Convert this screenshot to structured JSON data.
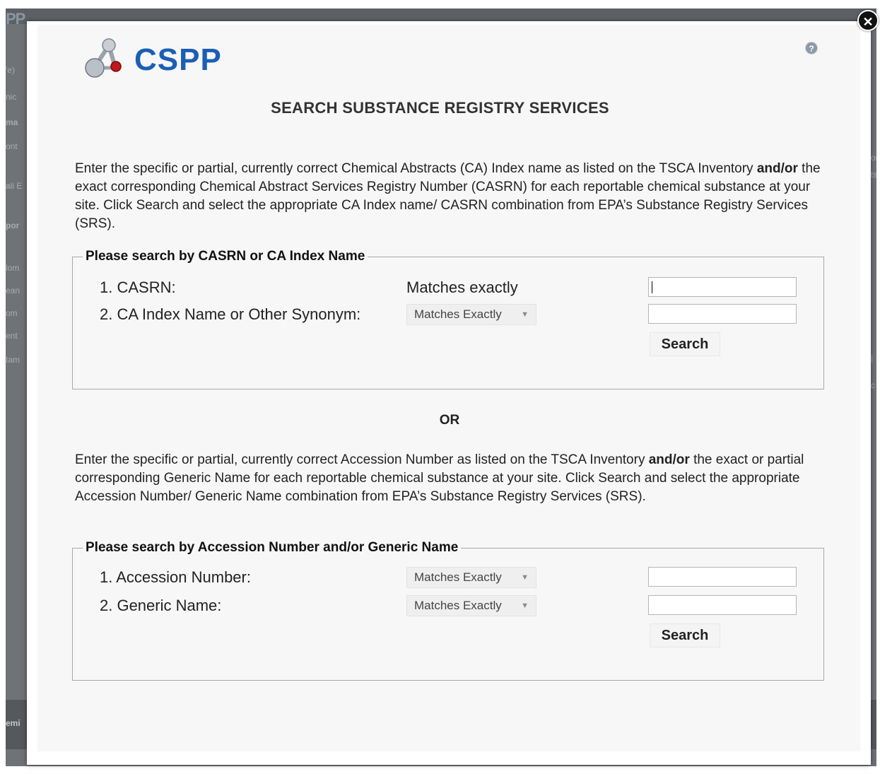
{
  "app": {
    "logo_text": "CSPP"
  },
  "background": {
    "ghost_logo": "PP",
    "side_snippets": [
      "'e)",
      "nic",
      "ma",
      "ont",
      "ali E",
      "por",
      "lom",
      "ean",
      "om",
      "ent",
      "Iam"
    ],
    "right_snippets": [
      "or",
      "ts",
      "|",
      "c"
    ],
    "bottom_text": "emi"
  },
  "dialog": {
    "title": "SEARCH SUBSTANCE REGISTRY SERVICES",
    "help_icon": "help-icon",
    "close_icon": "close-icon",
    "or_label": "OR",
    "intro1": {
      "part1": "Enter the specific or partial, currently correct Chemical Abstracts (CA) Index name as listed on the TSCA Inventory ",
      "bold1": "and/or",
      "part2": " the exact corresponding Chemical Abstract Services Registry Number (CASRN) for each reportable chemical substance at your site. Click Search and select the appropriate CA Index name/ CASRN combination from EPA’s Substance Registry Services (SRS)."
    },
    "intro2": {
      "part1": "Enter the specific or partial, currently correct Accession Number as listed on the TSCA Inventory ",
      "bold1": "and/or",
      "part2": " the exact or partial corresponding Generic Name for each reportable chemical substance at your site. Click Search and select the appropriate Accession Number/ Generic Name combination from EPA’s Substance Registry Services (SRS)."
    },
    "group1": {
      "legend": "Please search by CASRN or CA Index Name",
      "row1_label": "1. CASRN:",
      "row1_match": "Matches exactly",
      "row1_value": "",
      "row2_label": "2. CA Index Name or Other Synonym:",
      "row2_select": "Matches Exactly",
      "row2_value": "",
      "search_label": "Search"
    },
    "group2": {
      "legend": "Please search by Accession Number and/or Generic Name",
      "row1_label": "1. Accession Number:",
      "row1_select": "Matches Exactly",
      "row1_value": "",
      "row2_label": "2. Generic Name:",
      "row2_select": "Matches Exactly",
      "row2_value": "",
      "search_label": "Search"
    }
  }
}
